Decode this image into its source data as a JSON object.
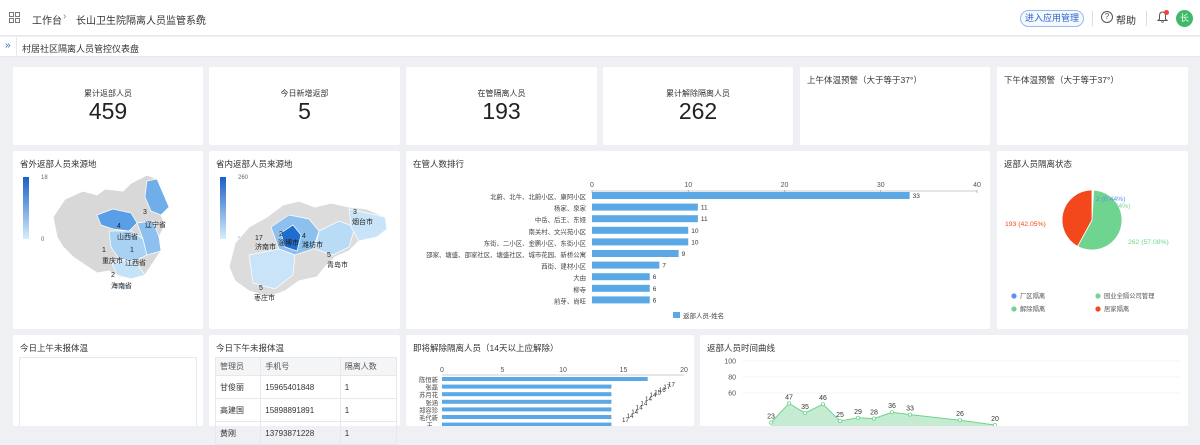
{
  "header": {
    "workspace": "工作台",
    "system_name": "长山卫生院隔离人员监管系统",
    "enter_app": "进入应用管理",
    "help": "帮助",
    "avatar": "长"
  },
  "tab": {
    "name": "村居社区隔离人员管控仪表盘"
  },
  "stats": [
    {
      "label": "累计返部人员",
      "value": "459"
    },
    {
      "label": "今日新增返部",
      "value": "5"
    },
    {
      "label": "在管隔离人员",
      "value": "193"
    },
    {
      "label": "累计解除隔离人员",
      "value": "262"
    }
  ],
  "warn_am": {
    "title": "上午体温预警（大于等于37°）"
  },
  "warn_pm": {
    "title": "下午体温预警（大于等于37°）"
  },
  "map_out": {
    "title": "省外返部人员来源地",
    "scale_max": "18",
    "scale_min": "0",
    "labels": [
      {
        "num": "3",
        "name": "辽宁省"
      },
      {
        "num": "4",
        "name": "山西省"
      },
      {
        "num": "1",
        "name": "重庆市"
      },
      {
        "num": "1",
        "name": "江西省"
      },
      {
        "num": "2",
        "name": "海南省"
      }
    ]
  },
  "map_in": {
    "title": "省内返部人员来源地",
    "scale_max": "260",
    "scale_min": "0",
    "labels": [
      {
        "num": "17",
        "name": "济南市"
      },
      {
        "num": "2",
        "name": "淄博市"
      },
      {
        "num": "4",
        "name": "潍坊市"
      },
      {
        "num": "3",
        "name": "烟台市"
      },
      {
        "num": "5",
        "name": "青岛市"
      },
      {
        "num": "5",
        "name": "枣庄市"
      }
    ]
  },
  "chart_data": [
    {
      "type": "bar",
      "title": "在管人数排行",
      "orientation": "horizontal",
      "categories": [
        "北蔚、北牛、北蔚小区、康阿小区",
        "杨家、泉家",
        "中岳、后王、东娅",
        "南关村、文兴苑小区",
        "东街、二小区、金鹏小区、东街小区",
        "邵家、塘盛、邵家社区、塘盛社区、城市花园、新桥公寓",
        "西街、建材小区",
        "大由",
        "柳寺",
        "前芽、尚旺"
      ],
      "series": [
        {
          "name": "返部人员-姓名",
          "values": [
            33,
            11,
            11,
            10,
            10,
            9,
            7,
            6,
            6,
            6
          ]
        }
      ],
      "xlim": [
        0,
        40
      ],
      "xticks": [
        "0",
        "10",
        "20",
        "30",
        "40"
      ],
      "color": "#5aa9e6"
    },
    {
      "type": "pie",
      "title": "返部人员隔离状态",
      "slices": [
        {
          "name": "厂区隔离",
          "value": 2,
          "label": "2 (0.44%)",
          "color": "#5b8ff9"
        },
        {
          "name": "园业全隔公司管理",
          "value": 2,
          "label": "2 (0.44%)",
          "color": "#79d296"
        },
        {
          "name": "解除隔离",
          "value": 262,
          "label": "262 (57.08%)",
          "color": "#6fd48f"
        },
        {
          "name": "居家隔离",
          "value": 193,
          "label": "193 (42.05%)",
          "color": "#f3471c"
        }
      ]
    },
    {
      "type": "bar",
      "title": "即将解除隔离人员（14天以上应解除）",
      "orientation": "horizontal",
      "categories": [
        "陈恒新",
        "张磊",
        "苏月花",
        "张涵",
        "郑容珍",
        "毛代新",
        "王..."
      ],
      "values": [
        17,
        14,
        14,
        14,
        14,
        14,
        14
      ],
      "value_labels": [
        "17",
        "14",
        "14",
        "14",
        "14",
        "14",
        "14",
        "15",
        "16",
        "17",
        "17"
      ],
      "xlim": [
        0,
        20
      ],
      "xticks": [
        "0",
        "5",
        "10",
        "15",
        "20"
      ],
      "color": "#5aa9e6"
    },
    {
      "type": "area",
      "title": "返部人员时间曲线",
      "yticks": [
        "100",
        "80",
        "60"
      ],
      "points": [
        {
          "label": "23",
          "value": 23
        },
        {
          "label": "47",
          "value": 47
        },
        {
          "label": "35",
          "value": 35
        },
        {
          "label": "46",
          "value": 46
        },
        {
          "label": "25",
          "value": 25
        },
        {
          "label": "29",
          "value": 29
        },
        {
          "label": "28",
          "value": 28
        },
        {
          "label": "36",
          "value": 36
        },
        {
          "label": "33",
          "value": 33
        },
        {
          "label": "26",
          "value": 26
        },
        {
          "label": "20",
          "value": 20
        }
      ],
      "color": "#6fd48f"
    }
  ],
  "am_unreported": {
    "title": "今日上午未报体温"
  },
  "pm_unreported": {
    "title": "今日下午未报体温",
    "columns": [
      "管理员",
      "手机号",
      "隔离人数"
    ],
    "rows": [
      [
        "甘俊丽",
        "15965401848",
        "1"
      ],
      [
        "高建国",
        "15898891891",
        "1"
      ],
      [
        "黄刚",
        "13793871228",
        "1"
      ]
    ]
  }
}
